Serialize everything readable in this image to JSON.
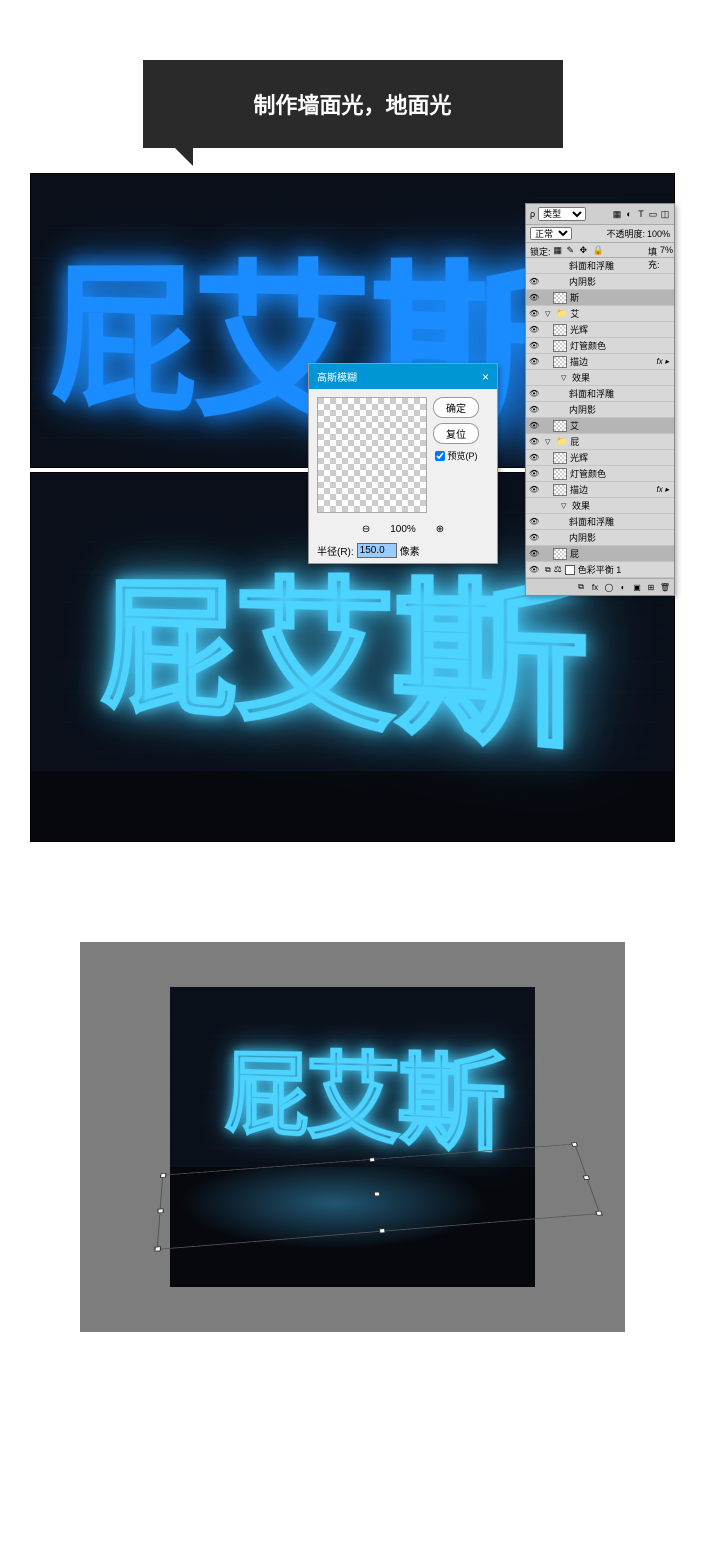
{
  "title": "制作墙面光，地面光",
  "neon_text": "屁艾斯",
  "dialog": {
    "title": "高斯模糊",
    "ok": "确定",
    "reset": "复位",
    "preview": "预览(P)",
    "zoom": "100%",
    "radius_label": "半径(R):",
    "radius_value": "150.0",
    "radius_unit": "像素"
  },
  "layers": {
    "kind": "类型",
    "blend": "正常",
    "opacity_label": "不透明度:",
    "opacity_value": "100%",
    "fill_label": "填充:",
    "fill_value": "7%",
    "lock_label": "锁定:",
    "rows": [
      {
        "eye": false,
        "indent": 3,
        "label": "斜面和浮雕",
        "type": "fx-item"
      },
      {
        "eye": true,
        "indent": 3,
        "label": "内阴影",
        "type": "fx-item"
      },
      {
        "eye": true,
        "indent": 1,
        "label": "斯",
        "type": "layer",
        "sel": true,
        "thumb": true
      },
      {
        "eye": true,
        "indent": 0,
        "label": "艾",
        "type": "group",
        "arrow": "▽"
      },
      {
        "eye": true,
        "indent": 1,
        "label": "光辉",
        "type": "layer",
        "thumb": true
      },
      {
        "eye": true,
        "indent": 1,
        "label": "灯管颜色",
        "type": "layer",
        "thumb": true
      },
      {
        "eye": true,
        "indent": 1,
        "label": "描边",
        "type": "layer",
        "thumb": true,
        "fx": "fx ▸"
      },
      {
        "eye": false,
        "indent": 2,
        "label": "效果",
        "type": "fx-head",
        "arrow": "▽"
      },
      {
        "eye": true,
        "indent": 3,
        "label": "斜面和浮雕",
        "type": "fx-item"
      },
      {
        "eye": true,
        "indent": 3,
        "label": "内阴影",
        "type": "fx-item"
      },
      {
        "eye": true,
        "indent": 1,
        "label": "艾",
        "type": "layer",
        "sel": true,
        "thumb": true
      },
      {
        "eye": true,
        "indent": 0,
        "label": "屁",
        "type": "group",
        "arrow": "▽"
      },
      {
        "eye": true,
        "indent": 1,
        "label": "光辉",
        "type": "layer",
        "thumb": true
      },
      {
        "eye": true,
        "indent": 1,
        "label": "灯管颜色",
        "type": "layer",
        "thumb": true
      },
      {
        "eye": true,
        "indent": 1,
        "label": "描边",
        "type": "layer",
        "thumb": true,
        "fx": "fx ▸"
      },
      {
        "eye": false,
        "indent": 2,
        "label": "效果",
        "type": "fx-head",
        "arrow": "▽"
      },
      {
        "eye": true,
        "indent": 3,
        "label": "斜面和浮雕",
        "type": "fx-item"
      },
      {
        "eye": true,
        "indent": 3,
        "label": "内阴影",
        "type": "fx-item"
      },
      {
        "eye": true,
        "indent": 1,
        "label": "屁",
        "type": "layer",
        "sel": true,
        "thumb": true
      },
      {
        "eye": true,
        "indent": 0,
        "label": "色彩平衡 1",
        "type": "adjust",
        "swatch": "#fff"
      }
    ]
  }
}
